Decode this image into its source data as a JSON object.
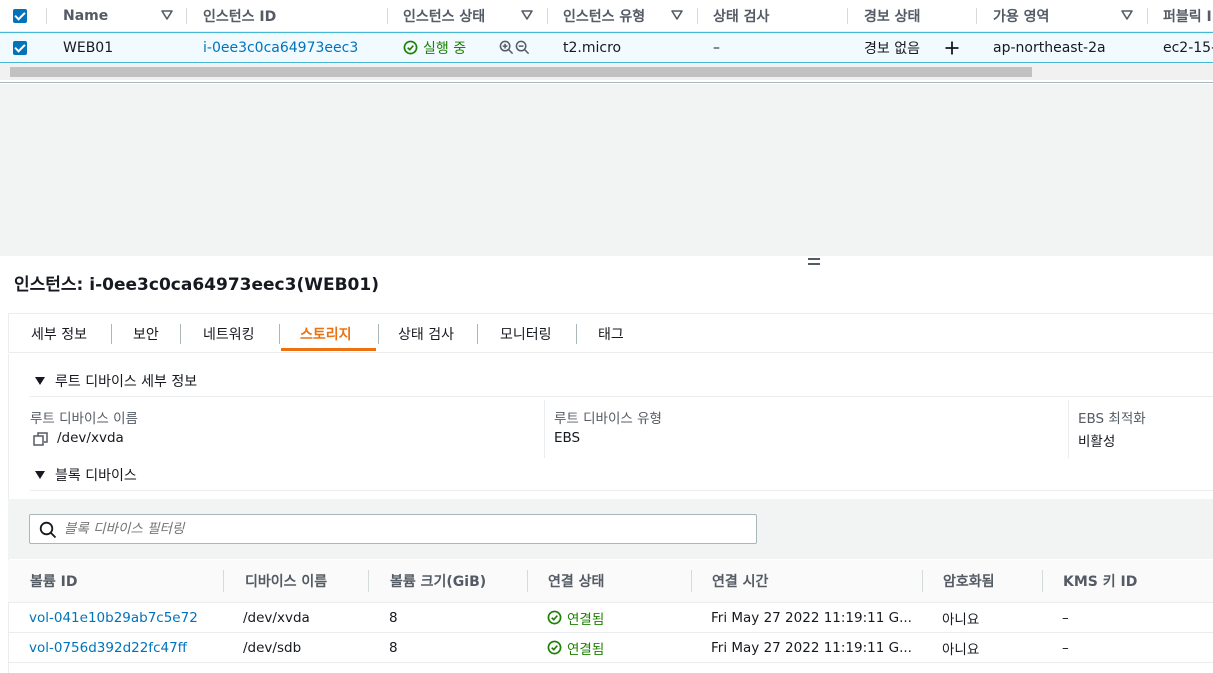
{
  "instance_table": {
    "headers": {
      "name": "Name",
      "instance_id": "인스턴스 ID",
      "instance_state": "인스턴스 상태",
      "instance_type": "인스턴스 유형",
      "status_check": "상태 검사",
      "alarm_status": "경보 상태",
      "availability_zone": "가용 영역",
      "public": "퍼블릭 I"
    },
    "row": {
      "name": "WEB01",
      "instance_id": "i-0ee3c0ca64973eec3",
      "state": "실행 중",
      "type": "t2.micro",
      "status_check": "–",
      "alarm": "경보 없음",
      "alarm_add": "+",
      "zone": "ap-northeast-2a",
      "public": "ec2-15-"
    }
  },
  "details": {
    "title": "인스턴스: i-0ee3c0ca64973eec3(WEB01)",
    "tabs": [
      "세부 정보",
      "보안",
      "네트워킹",
      "스토리지",
      "상태 검사",
      "모니터링",
      "태그"
    ],
    "active_tab": "스토리지",
    "root_section": {
      "heading": "루트 디바이스 세부 정보",
      "device_name_label": "루트 디바이스 이름",
      "device_name_value": "/dev/xvda",
      "device_type_label": "루트 디바이스 유형",
      "device_type_value": "EBS",
      "ebs_opt_label": "EBS 최적화",
      "ebs_opt_value": "비활성"
    },
    "block_section": {
      "heading": "블록 디바이스",
      "filter_placeholder": "블록 디바이스 필터링",
      "columns": [
        "볼륨 ID",
        "디바이스 이름",
        "볼륨 크기(GiB)",
        "연결 상태",
        "연결 시간",
        "암호화됨",
        "KMS 키 ID"
      ],
      "rows": [
        {
          "volume_id": "vol-041e10b29ab7c5e72",
          "device": "/dev/xvda",
          "size": "8",
          "status": "연결됨",
          "time": "Fri May 27 2022 11:19:11 G...",
          "encrypted": "아니요",
          "kms": "–"
        },
        {
          "volume_id": "vol-0756d392d22fc47ff",
          "device": "/dev/sdb",
          "size": "8",
          "status": "연결됨",
          "time": "Fri May 27 2022 11:19:11 G...",
          "encrypted": "아니요",
          "kms": "–"
        }
      ]
    }
  },
  "colors": {
    "link": "#0073bb",
    "success": "#1d8102",
    "active_tab": "#ec7211",
    "selected_row": "#f1faff"
  },
  "icons": [
    "checkbox-checked-icon",
    "sort-caret-icon",
    "status-ok-icon",
    "zoom-in-icon",
    "zoom-out-icon",
    "plus-icon",
    "copy-icon",
    "search-icon",
    "caret-down-icon",
    "drag-handle-icon"
  ]
}
